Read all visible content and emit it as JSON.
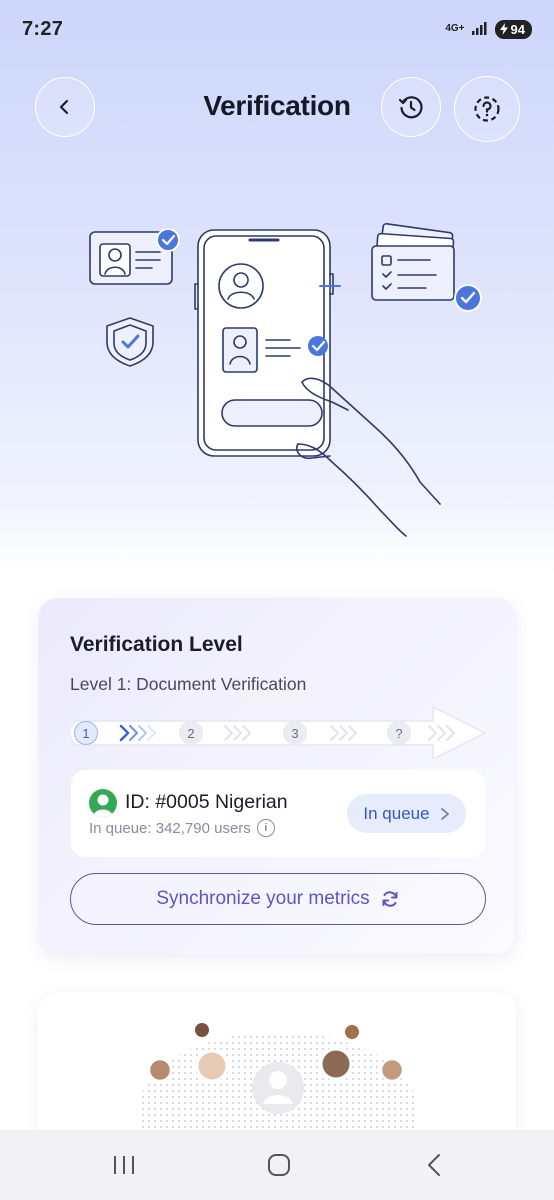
{
  "status_bar": {
    "time": "7:27",
    "network": "4G+",
    "battery": "94"
  },
  "header": {
    "title": "Verification",
    "back_icon": "chevron-left-icon",
    "history_icon": "history-icon",
    "help_icon": "help-circle-icon"
  },
  "verification_card": {
    "title": "Verification Level",
    "subtitle": "Level 1: Document Verification",
    "steps": [
      "1",
      "2",
      "3",
      "?"
    ],
    "active_step": "1",
    "id_label": "ID: #0005 Nigerian",
    "queue_text": "In queue: 342,790 users",
    "queue_button": "In queue",
    "sync_button": "Synchronize your metrics"
  },
  "colors": {
    "accent": "#3d5fd6",
    "sync_text": "#5b55c8",
    "avatar_green": "#34a853"
  }
}
